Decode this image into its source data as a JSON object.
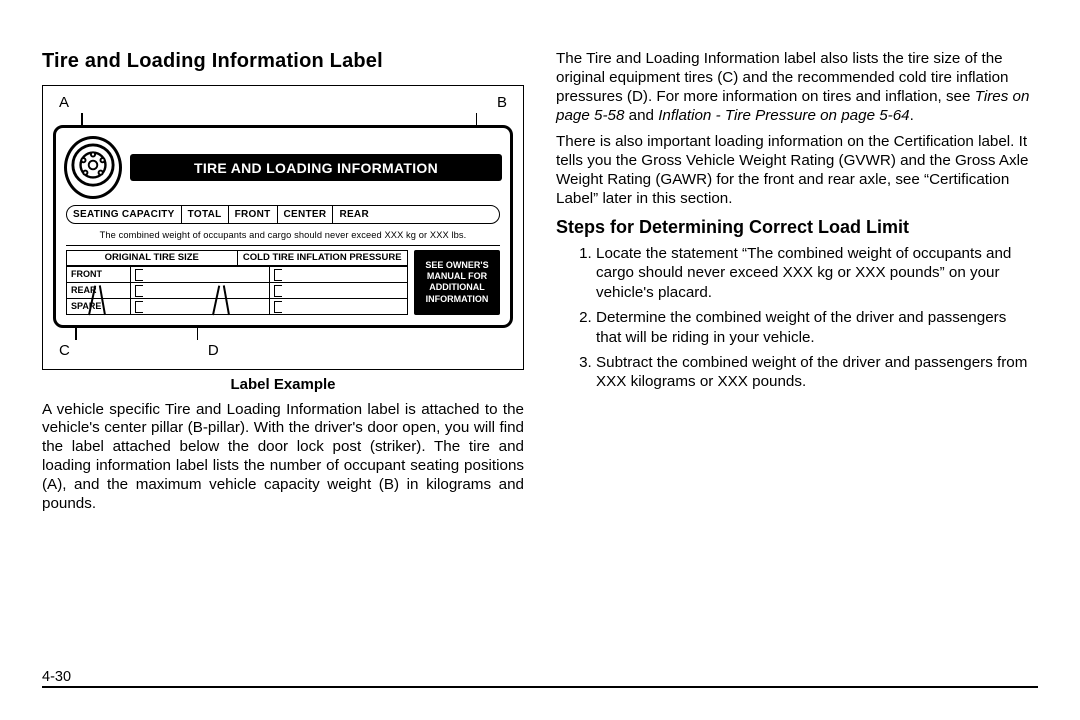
{
  "left": {
    "heading": "Tire and Loading Information Label",
    "callouts": {
      "A": "A",
      "B": "B",
      "C": "C",
      "D": "D"
    },
    "placard": {
      "banner": "TIRE AND LOADING INFORMATION",
      "seating": {
        "label": "SEATING CAPACITY",
        "total": "TOTAL",
        "front": "FRONT",
        "center": "CENTER",
        "rear": "REAR"
      },
      "weight_note": "The combined weight of occupants and cargo should never exceed XXX kg or XXX lbs.",
      "table": {
        "h1": "ORIGINAL TIRE SIZE",
        "h2": "COLD TIRE INFLATION PRESSURE",
        "rows": [
          "FRONT",
          "REAR",
          "SPARE"
        ]
      },
      "owners": {
        "l1": "SEE OWNER'S",
        "l2": "MANUAL FOR",
        "l3": "ADDITIONAL",
        "l4": "INFORMATION"
      }
    },
    "caption": "Label Example",
    "p1": "A vehicle specific Tire and Loading Information label is attached to the vehicle's center pillar (B-pillar). With the driver's door open, you will find the label attached below the door lock post (striker). The tire and loading information label lists the number of occupant seating positions (A), and the maximum vehicle capacity weight (B) in kilograms and pounds."
  },
  "right": {
    "p1a": "The Tire and Loading Information label also lists the tire size of the original equipment tires (C) and the recommended cold tire inflation pressures (D). For more information on tires and inflation, see ",
    "p1_ref1": "Tires on page 5-58",
    "p1b": " and ",
    "p1_ref2": "Inflation - Tire Pressure on page 5-64",
    "p1c": ".",
    "p2": "There is also important loading information on the Certification label. It tells you the Gross Vehicle Weight Rating (GVWR) and the Gross Axle Weight Rating (GAWR) for the front and rear axle, see “Certification Label” later in this section.",
    "h3": "Steps for Determining Correct Load Limit",
    "steps": [
      "Locate the statement “The combined weight of occupants and cargo should never exceed XXX kg or XXX pounds” on your vehicle's placard.",
      "Determine the combined weight of the driver and passengers that will be riding in your vehicle.",
      "Subtract the combined weight of the driver and passengers from XXX kilograms or XXX pounds."
    ]
  },
  "page_number": "4-30"
}
